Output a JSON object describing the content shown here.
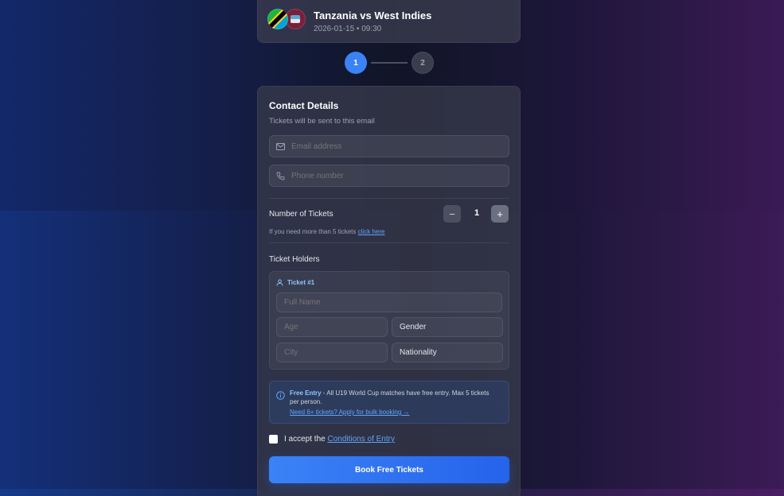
{
  "match": {
    "title": "Tanzania vs West Indies",
    "datetime": "2026-01-15 • 09:30",
    "team_a_flag": "tanzania-flag",
    "team_b_flag": "west-indies-flag"
  },
  "stepper": {
    "steps": [
      "1",
      "2"
    ],
    "active_step": 1
  },
  "contact": {
    "title": "Contact Details",
    "subtitle": "Tickets will be sent to this email",
    "email_placeholder": "Email address",
    "phone_placeholder": "Phone number"
  },
  "tickets": {
    "label": "Number of Tickets",
    "quantity": "1",
    "minus": "−",
    "plus": "+",
    "note": "If you need more than 5 tickets",
    "note_link": "click here"
  },
  "holders": {
    "label": "Ticket Holders",
    "ticket_label": "Ticket #1",
    "full_name_placeholder": "Full Name",
    "age_placeholder": "Age",
    "gender_label": "Gender",
    "city_placeholder": "City",
    "nationality_label": "Nationality"
  },
  "info": {
    "bold": "Free Entry",
    "text": " - All U19 World Cup matches have free entry. Max 5 tickets per person.",
    "link": "Need 6+ tickets? Apply for bulk booking →"
  },
  "accept": {
    "text": "I accept the",
    "link": "Conditions of Entry"
  },
  "submit_label": "Book Free Tickets",
  "colors": {
    "accent": "#3b82f6",
    "link": "#60a5fa"
  }
}
